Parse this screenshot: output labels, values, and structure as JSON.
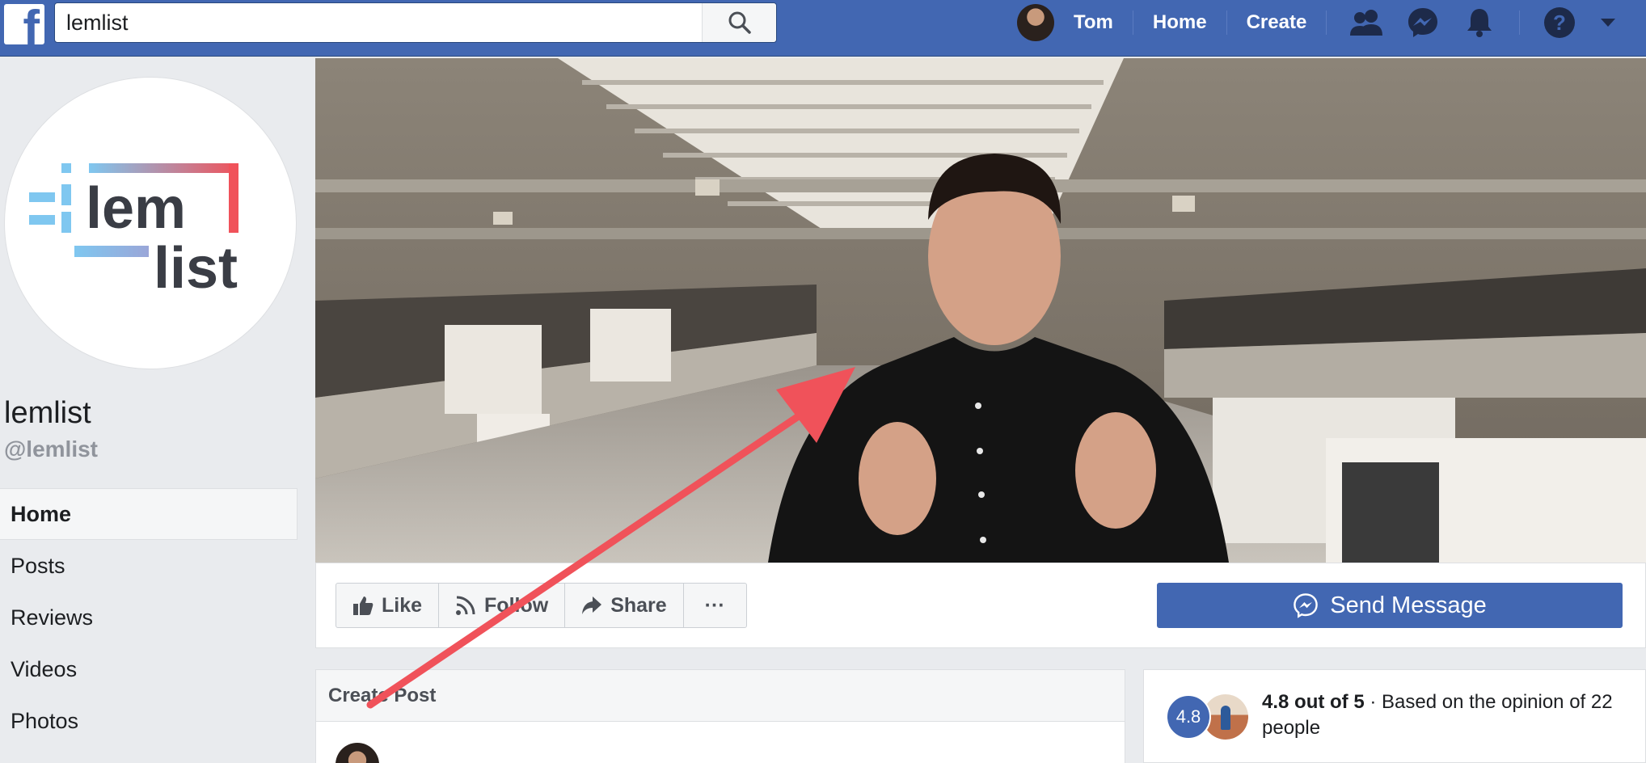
{
  "topbar": {
    "search_value": "lemlist",
    "user_name": "Tom",
    "nav_home": "Home",
    "nav_create": "Create",
    "brand_color": "#4267b2"
  },
  "profile": {
    "logo_line1": "lem",
    "logo_line2": "list",
    "name": "lemlist",
    "handle": "@lemlist"
  },
  "sidebar": {
    "items": [
      {
        "label": "Home",
        "active": true
      },
      {
        "label": "Posts"
      },
      {
        "label": "Reviews"
      },
      {
        "label": "Videos"
      },
      {
        "label": "Photos"
      }
    ]
  },
  "actions": {
    "like": "Like",
    "follow": "Follow",
    "share": "Share",
    "more": "···",
    "send_message": "Send Message"
  },
  "create_post": {
    "title": "Create Post"
  },
  "rating": {
    "badge": "4.8",
    "score_text": "4.8 out of 5",
    "separator": " · ",
    "detail": "Based on the opinion of 22 people"
  },
  "annotation": {
    "arrow_color": "#f0525a"
  }
}
